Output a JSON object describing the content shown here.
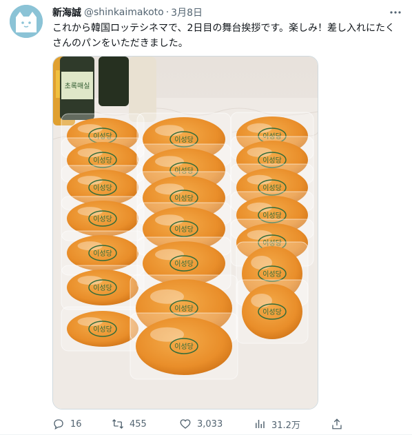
{
  "author": {
    "name": "新海誠",
    "handle": "@shinkaimakoto",
    "separator": "·",
    "date": "3月8日"
  },
  "tweet": {
    "text": "これから韓国ロッテシネマで、2日目の舞台挨拶です。楽しみ！差し入れにたくさんのパンをいただきました。"
  },
  "media": {
    "bread_label": "이성당",
    "bottle_label": "초록매실"
  },
  "actions": {
    "replies": "16",
    "retweets": "455",
    "likes": "3,033",
    "views": "31.2万"
  },
  "colors": {
    "secondary_text": "#536471",
    "avatar_bg": "#8bc3d6",
    "bun_orange": "#e98e2a"
  },
  "icons": [
    "avatar-cat-icon",
    "more-icon",
    "reply-icon",
    "retweet-icon",
    "like-icon",
    "views-icon",
    "share-icon"
  ]
}
